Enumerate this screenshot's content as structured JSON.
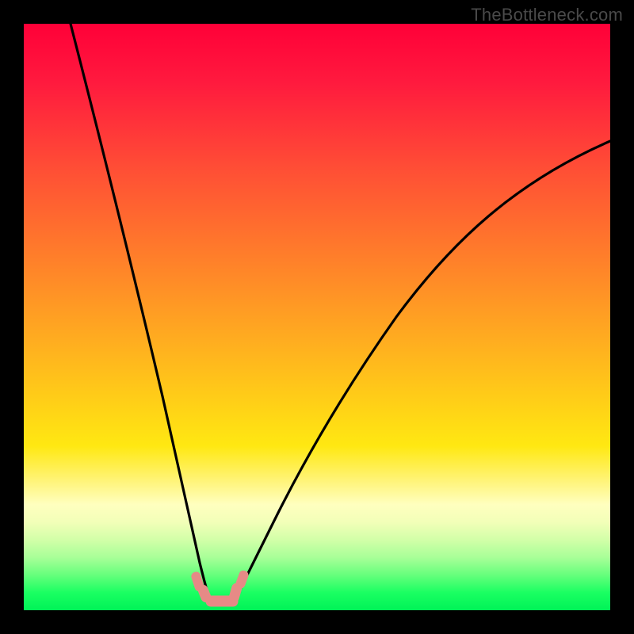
{
  "watermark": "TheBottleneck.com",
  "chart_data": {
    "type": "line",
    "title": "",
    "xlabel": "",
    "ylabel": "",
    "xlim": [
      0,
      100
    ],
    "ylim": [
      0,
      100
    ],
    "gradient_stops": [
      {
        "pct": 0,
        "color": "#ff0038"
      },
      {
        "pct": 25,
        "color": "#ff4f35"
      },
      {
        "pct": 55,
        "color": "#ffb01f"
      },
      {
        "pct": 72,
        "color": "#ffe812"
      },
      {
        "pct": 85,
        "color": "#f2ffb8"
      },
      {
        "pct": 100,
        "color": "#00f357"
      }
    ],
    "series": [
      {
        "name": "left-branch",
        "x": [
          8,
          12,
          16,
          20,
          23,
          26,
          28,
          29.5,
          30.5,
          31.5
        ],
        "y": [
          100,
          74,
          52,
          34,
          22,
          12,
          6,
          3,
          2.2,
          2
        ]
      },
      {
        "name": "right-branch",
        "x": [
          36,
          37,
          39,
          43,
          48,
          55,
          63,
          72,
          82,
          92,
          100
        ],
        "y": [
          2,
          2.5,
          4,
          9,
          17,
          28,
          40,
          52,
          63,
          73,
          80
        ]
      },
      {
        "name": "trough-marks",
        "points": [
          {
            "x": 29.5,
            "y": 5
          },
          {
            "x": 30.5,
            "y": 2.2
          },
          {
            "x": 32,
            "y": 1.6
          },
          {
            "x": 34.5,
            "y": 1.6
          },
          {
            "x": 36,
            "y": 2.4
          },
          {
            "x": 36.8,
            "y": 5
          }
        ]
      }
    ]
  }
}
